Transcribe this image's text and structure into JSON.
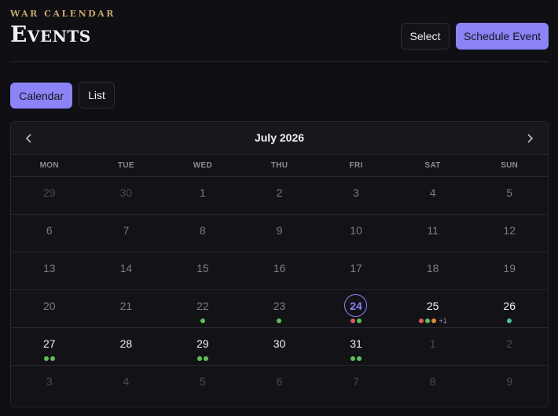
{
  "header": {
    "eyebrow": "WAR CALENDAR",
    "title": "Events",
    "select_label": "Select",
    "schedule_label": "Schedule Event"
  },
  "view_tabs": [
    "Calendar",
    "List"
  ],
  "calendar": {
    "month_label": "July 2026",
    "prev_icon": "chevron-left-icon",
    "next_icon": "chevron-right-icon",
    "weekdays": [
      "MON",
      "TUE",
      "WED",
      "THU",
      "FRI",
      "SAT",
      "SUN"
    ],
    "colors": {
      "green": "#5fbf5a",
      "red": "#e05a4e",
      "orange": "#e08a3c",
      "teal": "#4fbfa5",
      "accent": "#8b83f6"
    },
    "weeks": [
      [
        {
          "day": "29",
          "muted": true
        },
        {
          "day": "30",
          "muted": true
        },
        {
          "day": "1"
        },
        {
          "day": "2"
        },
        {
          "day": "3"
        },
        {
          "day": "4"
        },
        {
          "day": "5"
        }
      ],
      [
        {
          "day": "6"
        },
        {
          "day": "7"
        },
        {
          "day": "8"
        },
        {
          "day": "9"
        },
        {
          "day": "10"
        },
        {
          "day": "11"
        },
        {
          "day": "12"
        }
      ],
      [
        {
          "day": "13"
        },
        {
          "day": "14"
        },
        {
          "day": "15"
        },
        {
          "day": "16"
        },
        {
          "day": "17"
        },
        {
          "day": "18"
        },
        {
          "day": "19"
        }
      ],
      [
        {
          "day": "20"
        },
        {
          "day": "21"
        },
        {
          "day": "22",
          "dots": [
            "green"
          ]
        },
        {
          "day": "23",
          "dots": [
            "green"
          ]
        },
        {
          "day": "24",
          "today": true,
          "bright": true,
          "dots": [
            "red",
            "green"
          ]
        },
        {
          "day": "25",
          "bright": true,
          "dots": [
            "red",
            "green",
            "orange"
          ],
          "more": "+1"
        },
        {
          "day": "26",
          "bright": true,
          "dots": [
            "teal"
          ]
        }
      ],
      [
        {
          "day": "27",
          "bright": true,
          "dots": [
            "green",
            "green"
          ]
        },
        {
          "day": "28",
          "bright": true
        },
        {
          "day": "29",
          "bright": true,
          "dots": [
            "green",
            "green"
          ]
        },
        {
          "day": "30",
          "bright": true
        },
        {
          "day": "31",
          "bright": true,
          "dots": [
            "green",
            "green"
          ]
        },
        {
          "day": "1",
          "muted": true
        },
        {
          "day": "2",
          "muted": true
        }
      ],
      [
        {
          "day": "3",
          "muted": true
        },
        {
          "day": "4",
          "muted": true
        },
        {
          "day": "5",
          "muted": true
        },
        {
          "day": "6",
          "muted": true
        },
        {
          "day": "7",
          "muted": true
        },
        {
          "day": "8",
          "muted": true
        },
        {
          "day": "9",
          "muted": true
        }
      ]
    ]
  }
}
